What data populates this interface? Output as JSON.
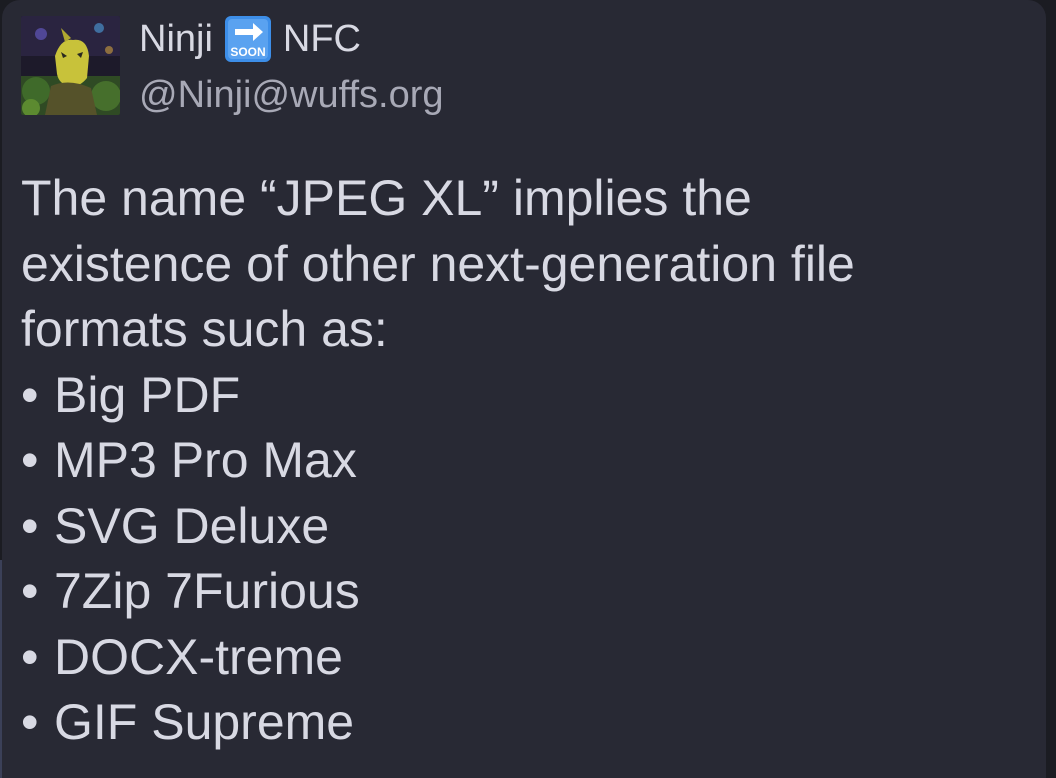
{
  "author": {
    "name_first": "Ninji",
    "name_emoji": "soon-arrow-emoji",
    "name_last": "NFC",
    "handle": "@Ninji@wuffs.org",
    "avatar_icon": "avatar-photo"
  },
  "post": {
    "intro_lines": [
      "The name “JPEG XL” implies the",
      "existence of other next-generation file",
      "formats such as:"
    ],
    "bullet_char": "•",
    "items": [
      "Big PDF",
      "MP3 Pro Max",
      "SVG Deluxe",
      "7Zip 7Furious",
      "DOCX-treme",
      "GIF Supreme"
    ]
  },
  "colors": {
    "card_background": "#282934",
    "text_primary": "#d8d9e3",
    "text_secondary": "#a8a9b6",
    "emoji_blue": "#3d8ee8"
  }
}
